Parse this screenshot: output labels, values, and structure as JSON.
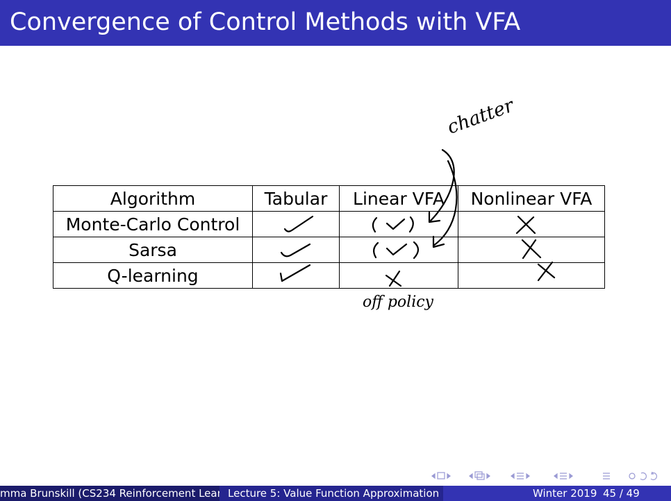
{
  "slide": {
    "title": "Convergence of Control Methods with VFA",
    "table": {
      "headers": [
        "Algorithm",
        "Tabular",
        "Linear VFA",
        "Nonlinear VFA"
      ],
      "rows": [
        [
          "Monte-Carlo Control",
          "",
          "",
          ""
        ],
        [
          "Sarsa",
          "",
          "",
          ""
        ],
        [
          "Q-learning",
          "",
          "",
          ""
        ]
      ]
    },
    "annotations": {
      "chatter": "chatter",
      "off_policy": "off policy"
    }
  },
  "footer": {
    "author": "mma Brunskill (CS234 Reinforcement Learn",
    "lecture": "Lecture 5: Value Function Approximation",
    "term": "Winter 2019",
    "page": "45 / 49"
  },
  "colors": {
    "title_bar": "#3333b3",
    "footer_dark": "#1b1b6b",
    "footer_mid": "#25258f",
    "footer_light": "#3333b3"
  }
}
